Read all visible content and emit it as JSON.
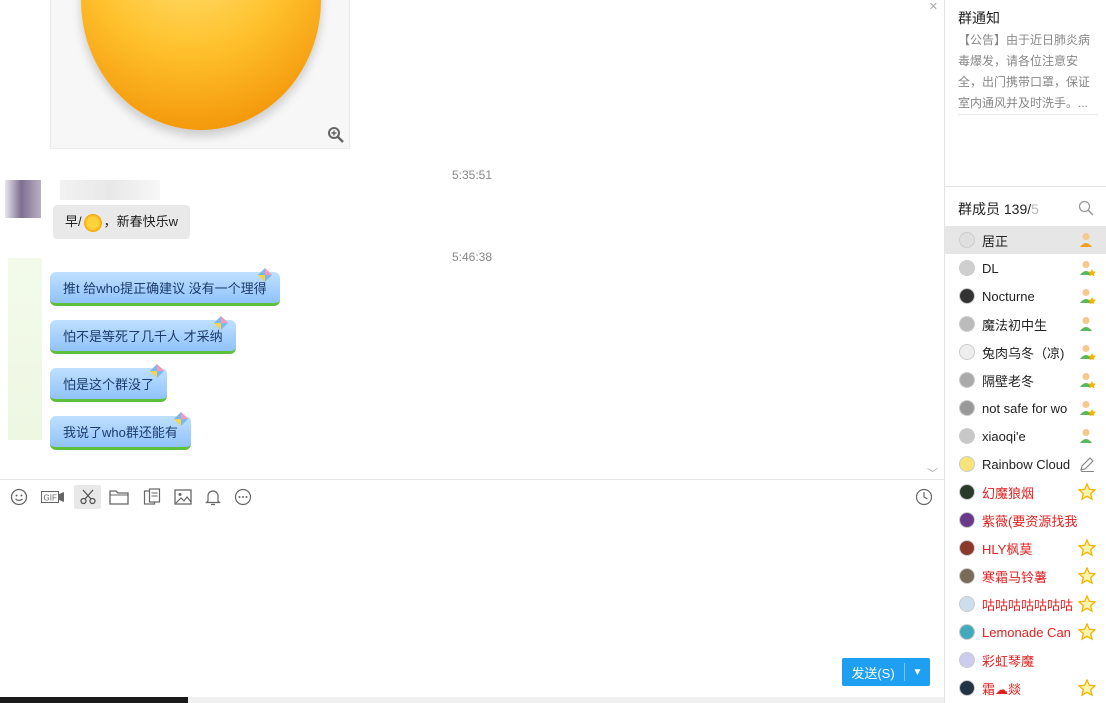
{
  "chat": {
    "timestamps": [
      "5:35:51",
      "5:46:38"
    ],
    "gray_message": {
      "prefix": "早/",
      "suffix": "，新春快乐w"
    },
    "blue_messages": [
      "推t 给who提正确建议 没有一个理得",
      "怕不是等死了几千人 才采纳",
      "怕是这个群没了",
      "我说了who群还能有"
    ]
  },
  "toolbar": {
    "icons": [
      "emoji-icon",
      "gif-icon",
      "scissors-icon",
      "folder-icon",
      "doc-icon",
      "image-icon",
      "bell-icon",
      "more-icon",
      "history-icon"
    ]
  },
  "send": {
    "label": "发送(S)"
  },
  "notice": {
    "title": "群通知",
    "body": "【公告】由于近日肺炎病毒爆发，请各位注意安全，出门携带口罩，保证室内通风并及时洗手。..."
  },
  "members_header": {
    "label": "群成员 139/",
    "count_tail": "5"
  },
  "members": [
    {
      "name": "居正",
      "role": "owner",
      "red": false,
      "selected": true
    },
    {
      "name": "DL",
      "role": "admin",
      "red": false
    },
    {
      "name": "Nocturne",
      "role": "admin",
      "red": false
    },
    {
      "name": "魔法初中生",
      "role": "member",
      "red": false
    },
    {
      "name": "兔肉乌冬（凉)",
      "role": "admin",
      "red": false
    },
    {
      "name": "隔壁老冬",
      "role": "admin",
      "red": false
    },
    {
      "name": "not safe for wo",
      "role": "admin",
      "red": false
    },
    {
      "name": "xiaoqi'e",
      "role": "member",
      "red": false
    },
    {
      "name": "Rainbow Cloud",
      "role": "edit",
      "red": false
    },
    {
      "name": "幻魔狼烟",
      "role": "star",
      "red": true
    },
    {
      "name": "紫薇(要资源找我)",
      "role": "none",
      "red": true
    },
    {
      "name": "HLY枫莫",
      "role": "star",
      "red": true
    },
    {
      "name": "寒霜马铃薯",
      "role": "star",
      "red": true
    },
    {
      "name": "咕咕咕咕咕咕咕",
      "role": "star",
      "red": true
    },
    {
      "name": "Lemonade Can",
      "role": "star",
      "red": true
    },
    {
      "name": "彩虹琴魔",
      "role": "none",
      "red": true
    },
    {
      "name": "霜☁燚",
      "role": "star",
      "red": true
    }
  ],
  "colors": {
    "send": "#1e9ff2",
    "bubble_blue": "#8fc3fb",
    "bubble_border": "#5fbf3f",
    "red_name": "#e02020",
    "star": "#f4b400"
  }
}
